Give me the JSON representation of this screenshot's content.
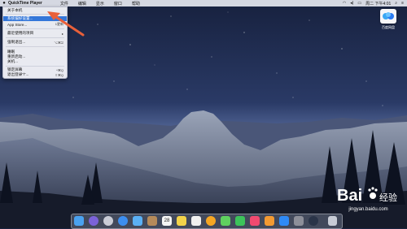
{
  "menubar": {
    "app_name": "QuickTime Player",
    "items": [
      "文件",
      "编辑",
      "显示",
      "窗口",
      "帮助"
    ],
    "clock": "周二 下午4:01"
  },
  "apple_menu": {
    "items": [
      {
        "label": "关于本机",
        "shortcut": ""
      },
      {
        "label": "系统偏好设置...",
        "shortcut": ""
      },
      {
        "label": "App Store...",
        "shortcut": "1更新"
      },
      {
        "label": "最近使用的项目",
        "shortcut": "▸"
      },
      {
        "label": "强制退出...",
        "shortcut": "⌥⌘⎋"
      },
      {
        "label": "睡眠",
        "shortcut": ""
      },
      {
        "label": "重新启动...",
        "shortcut": ""
      },
      {
        "label": "关机...",
        "shortcut": ""
      },
      {
        "label": "锁定屏幕",
        "shortcut": "^⌘Q"
      },
      {
        "label": "退出登录“l”...",
        "shortcut": "⇧⌘Q"
      }
    ]
  },
  "desktop": {
    "icon_label": "百度网盘"
  },
  "dock": {
    "icons": [
      "finder-icon",
      "siri-icon",
      "launchpad-icon",
      "safari-icon",
      "mail-icon",
      "contacts-icon",
      "calendar-icon",
      "notes-icon",
      "reminders-icon",
      "photos-icon",
      "messages-icon",
      "facetime-icon",
      "music-icon",
      "books-icon",
      "app-store-icon",
      "system-preferences-icon",
      "quicktime-icon",
      "trash-icon"
    ],
    "calendar_day": "28"
  },
  "watermark": {
    "logo_text": "Bai",
    "logo_suffix": "经验",
    "site": "jingyan.baidu.com"
  },
  "colors": {
    "menu_highlight": "#3477d9",
    "arrow": "#e8603a",
    "sky_top": "#1e2b4d",
    "sky_bottom": "#5b6fa0"
  }
}
